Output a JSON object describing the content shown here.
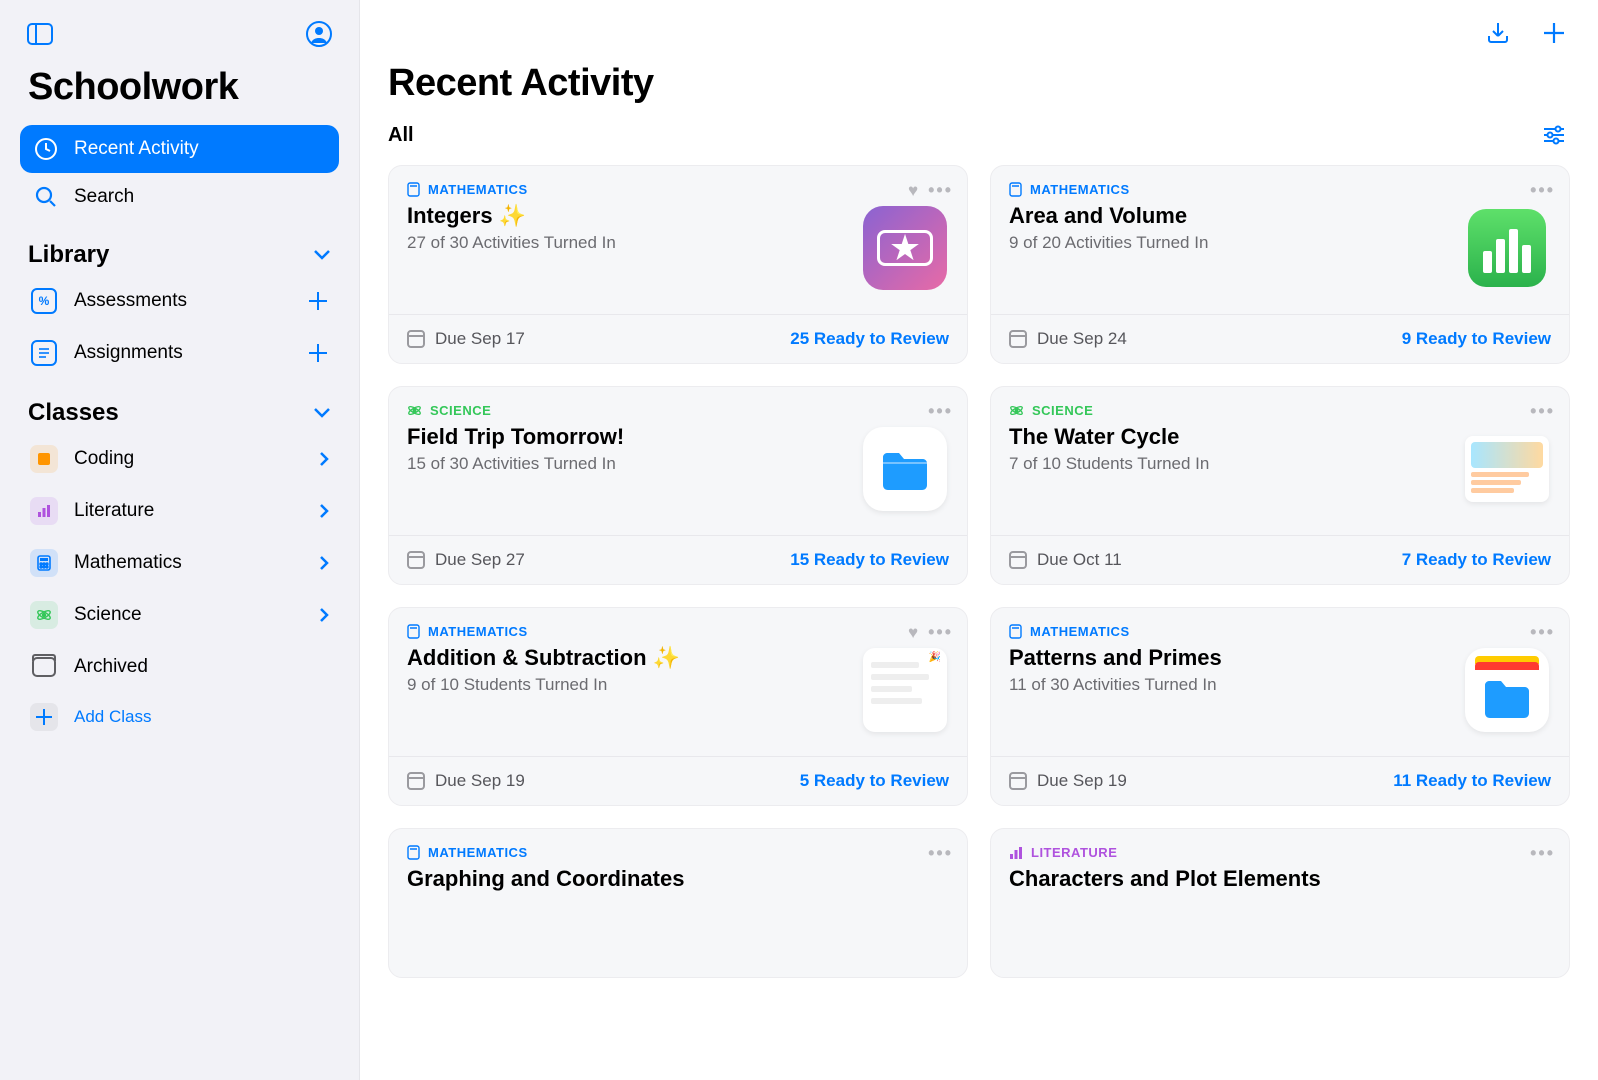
{
  "app_title": "Schoolwork",
  "sidebar": {
    "nav": [
      {
        "id": "recent",
        "label": "Recent Activity",
        "active": true
      },
      {
        "id": "search",
        "label": "Search",
        "active": false
      }
    ],
    "library": {
      "title": "Library",
      "items": [
        {
          "id": "assessments",
          "label": "Assessments"
        },
        {
          "id": "assignments",
          "label": "Assignments"
        }
      ]
    },
    "classes": {
      "title": "Classes",
      "items": [
        {
          "id": "coding",
          "label": "Coding",
          "color": "#FF9500",
          "icon": "code"
        },
        {
          "id": "literature",
          "label": "Literature",
          "color": "#AF52DE",
          "icon": "bars"
        },
        {
          "id": "mathematics",
          "label": "Mathematics",
          "color": "#007AFF",
          "icon": "calc"
        },
        {
          "id": "science",
          "label": "Science",
          "color": "#34C759",
          "icon": "atom"
        }
      ],
      "archived": "Archived",
      "add": "Add Class"
    }
  },
  "main": {
    "title": "Recent Activity",
    "filter": "All",
    "cards": [
      {
        "subject": "MATHEMATICS",
        "subject_color": "#007AFF",
        "subject_icon": "calc",
        "title": "Integers ✨",
        "subtitle": "27 of 30 Activities Turned In",
        "due": "Due Sep 17",
        "ready": "25 Ready to Review",
        "fav": true,
        "thumb": "ticket"
      },
      {
        "subject": "MATHEMATICS",
        "subject_color": "#007AFF",
        "subject_icon": "calc",
        "title": "Area and Volume",
        "subtitle": "9 of 20 Activities Turned In",
        "due": "Due Sep 24",
        "ready": "9 Ready to Review",
        "fav": false,
        "thumb": "numbers"
      },
      {
        "subject": "SCIENCE",
        "subject_color": "#34C759",
        "subject_icon": "atom",
        "title": "Field Trip Tomorrow!",
        "subtitle": "15 of 30 Activities Turned In",
        "due": "Due Sep 27",
        "ready": "15 Ready to Review",
        "fav": false,
        "thumb": "files"
      },
      {
        "subject": "SCIENCE",
        "subject_color": "#34C759",
        "subject_icon": "atom",
        "title": "The Water Cycle",
        "subtitle": "7 of 10 Students Turned In",
        "due": "Due Oct 11",
        "ready": "7 Ready to Review",
        "fav": false,
        "thumb": "doc-landscape"
      },
      {
        "subject": "MATHEMATICS",
        "subject_color": "#007AFF",
        "subject_icon": "calc",
        "title": "Addition & Subtraction ✨",
        "subtitle": "9 of 10 Students Turned In",
        "due": "Due Sep 19",
        "ready": "5 Ready to Review",
        "fav": true,
        "thumb": "doc-confetti"
      },
      {
        "subject": "MATHEMATICS",
        "subject_color": "#007AFF",
        "subject_icon": "calc",
        "title": "Patterns and Primes",
        "subtitle": "11 of 30 Activities Turned In",
        "due": "Due Sep 19",
        "ready": "11 Ready to Review",
        "fav": false,
        "thumb": "files-orange"
      },
      {
        "subject": "MATHEMATICS",
        "subject_color": "#007AFF",
        "subject_icon": "calc",
        "title": "Graphing and Coordinates",
        "subtitle": "",
        "due": "",
        "ready": "",
        "fav": false,
        "thumb": ""
      },
      {
        "subject": "LITERATURE",
        "subject_color": "#AF52DE",
        "subject_icon": "bars",
        "title": "Characters and Plot Elements",
        "subtitle": "",
        "due": "",
        "ready": "",
        "fav": false,
        "thumb": ""
      }
    ]
  }
}
